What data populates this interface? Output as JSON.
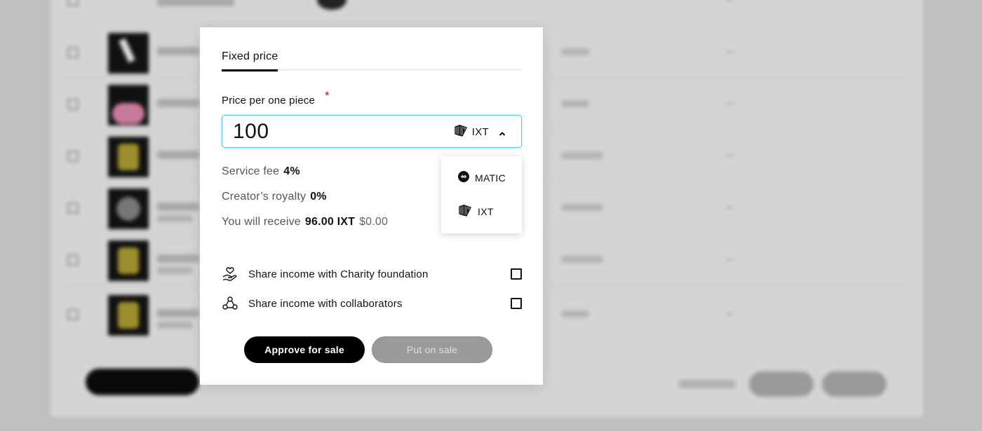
{
  "modal": {
    "tab_fixed_price": "Fixed price",
    "price_label": "Price per one piece",
    "required_mark": "*",
    "price_value": "100",
    "selected_currency": "IXT",
    "service_fee_label": "Service fee",
    "service_fee_value": "4%",
    "royalty_label": "Creator’s royalty",
    "royalty_value": "0%",
    "receive_label": "You will receive",
    "receive_value": "96.00 IXT",
    "receive_usd": "$0.00",
    "currency_options": [
      {
        "label": "MATIC",
        "icon": "matic-icon"
      },
      {
        "label": "IXT",
        "icon": "ixt-icon"
      }
    ],
    "share_charity_label": "Share income with Charity foundation",
    "share_collaborators_label": "Share income with collaborators",
    "approve_button": "Approve for sale",
    "put_on_sale_button": "Put on sale"
  },
  "colors": {
    "input_focus_border": "#5bc9e6",
    "required_star": "#8a2a2a",
    "primary_button": "#000000",
    "disabled_button": "#9b9b9b"
  }
}
